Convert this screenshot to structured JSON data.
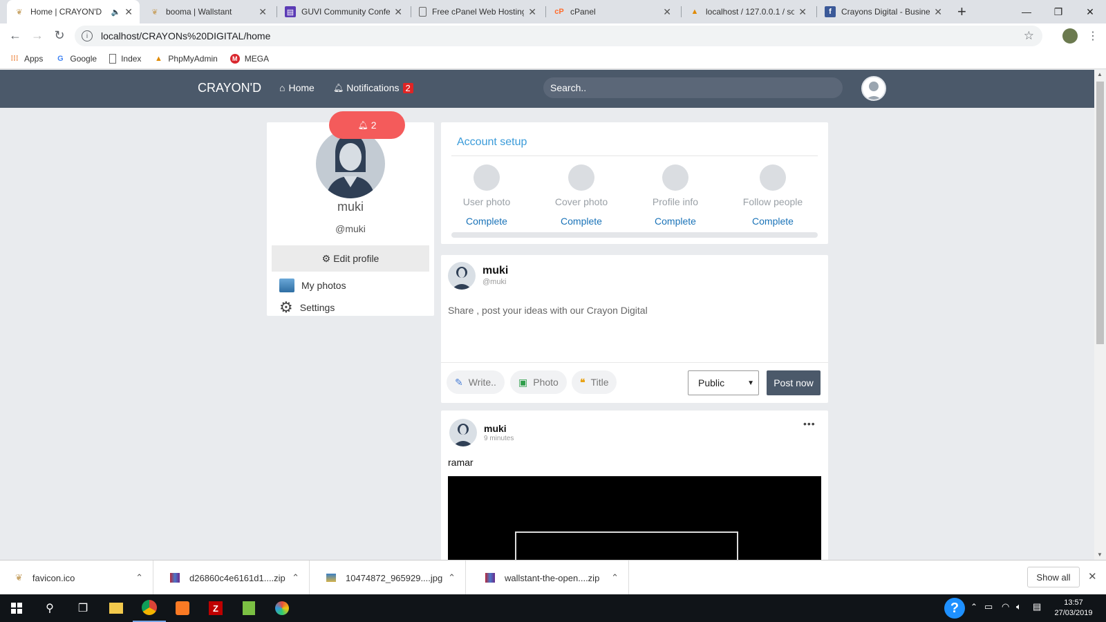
{
  "browser": {
    "tabs": [
      {
        "title": "Home | CRAYON'D",
        "active": true
      },
      {
        "title": "booma | Wallstant"
      },
      {
        "title": "GUVI Community Confer"
      },
      {
        "title": "Free cPanel Web Hosting"
      },
      {
        "title": "cPanel"
      },
      {
        "title": "localhost / 127.0.0.1 / so"
      },
      {
        "title": "Crayons Digital - Busine"
      }
    ],
    "url": "localhost/CRAYONs%20DIGITAL/home",
    "bookmarks": [
      "Apps",
      "Google",
      "Index",
      "PhpMyAdmin",
      "MEGA"
    ]
  },
  "site": {
    "brand": "CRAYON'D",
    "nav_home": "Home",
    "nav_notifications": "Notifications",
    "notification_count": "2",
    "search_placeholder": "Search.."
  },
  "profile": {
    "bell_count": "2",
    "name": "muki",
    "handle": "@muki",
    "edit_profile": "Edit profile",
    "menu": [
      "My photos",
      "Settings"
    ]
  },
  "account_setup": {
    "title": "Account setup",
    "steps": [
      {
        "label": "User photo",
        "status": "Complete"
      },
      {
        "label": "Cover photo",
        "status": "Complete"
      },
      {
        "label": "Profile info",
        "status": "Complete"
      },
      {
        "label": "Follow people",
        "status": "Complete"
      }
    ]
  },
  "composer": {
    "name": "muki",
    "handle": "@muki",
    "placeholder": "Share , post your ideas with our Crayon Digital",
    "actions": [
      "Write..",
      "Photo",
      "Title"
    ],
    "privacy": "Public",
    "post_button": "Post now"
  },
  "post": {
    "author": "muki",
    "time": "9 minutes",
    "text": "ramar",
    "menu": "•••"
  },
  "downloads": {
    "items": [
      "favicon.ico",
      "d26860c4e6161d1....zip",
      "10474872_965929....jpg",
      "wallstant-the-open....zip"
    ],
    "show_all": "Show all"
  },
  "taskbar": {
    "time": "13:57",
    "date": "27/03/2019"
  }
}
